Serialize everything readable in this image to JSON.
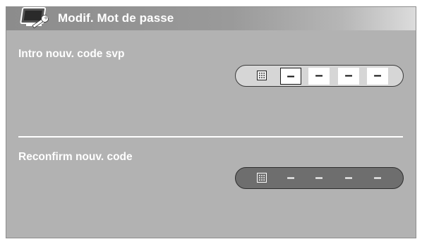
{
  "header": {
    "title": "Modif. Mot de passe",
    "icon": "monitor-wrench-icon"
  },
  "new_code": {
    "label": "Intro nouv. code svp",
    "keypad_icon": "keypad-icon",
    "slots": [
      "–",
      "–",
      "–",
      "–"
    ]
  },
  "confirm_code": {
    "label": "Reconfirm nouv. code",
    "keypad_icon": "keypad-icon",
    "slots": [
      "–",
      "–",
      "–",
      "–"
    ]
  },
  "colors": {
    "panel_bg": "#b2b2b2",
    "header_gradient_start": "#8c8c8c",
    "text": "#ffffff",
    "inactive_bar": "#6e6e6e"
  }
}
